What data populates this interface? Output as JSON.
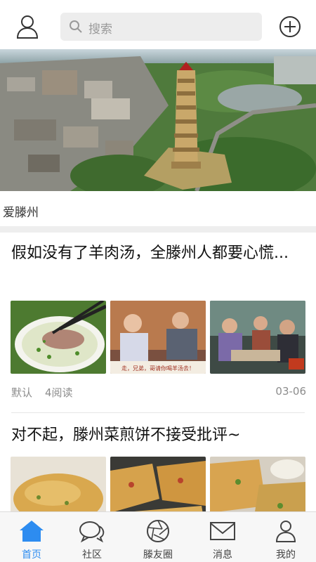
{
  "header": {
    "search_placeholder": "搜索"
  },
  "hero": {
    "caption": "爱滕州"
  },
  "articles": [
    {
      "title": "假如没有了羊肉汤，全滕州人都要心慌...",
      "thumbnails": [
        {
          "icon": "lamb-soup-photo"
        },
        {
          "icon": "tv-show-photo",
          "overlay_text": "走，兄弟，哥请你喝羊汤去！"
        },
        {
          "icon": "dining-tv-photo"
        }
      ],
      "source": "默认",
      "reads": "4阅读",
      "date": "03-06"
    },
    {
      "title": "对不起，滕州菜煎饼不接受批评~",
      "thumbnails": [
        {
          "icon": "pancake-photo"
        },
        {
          "icon": "pancake-photo"
        },
        {
          "icon": "pancake-photo"
        }
      ]
    }
  ],
  "tabbar": {
    "items": [
      {
        "label": "首页",
        "icon": "home-icon",
        "active": true
      },
      {
        "label": "社区",
        "icon": "chat-icon",
        "active": false
      },
      {
        "label": "滕友圈",
        "icon": "aperture-icon",
        "active": false
      },
      {
        "label": "消息",
        "icon": "mail-icon",
        "active": false
      },
      {
        "label": "我的",
        "icon": "person-icon",
        "active": false
      }
    ]
  },
  "colors": {
    "accent": "#2d8cf0",
    "separator": "#eeeeee",
    "search_bg": "#ededed"
  }
}
